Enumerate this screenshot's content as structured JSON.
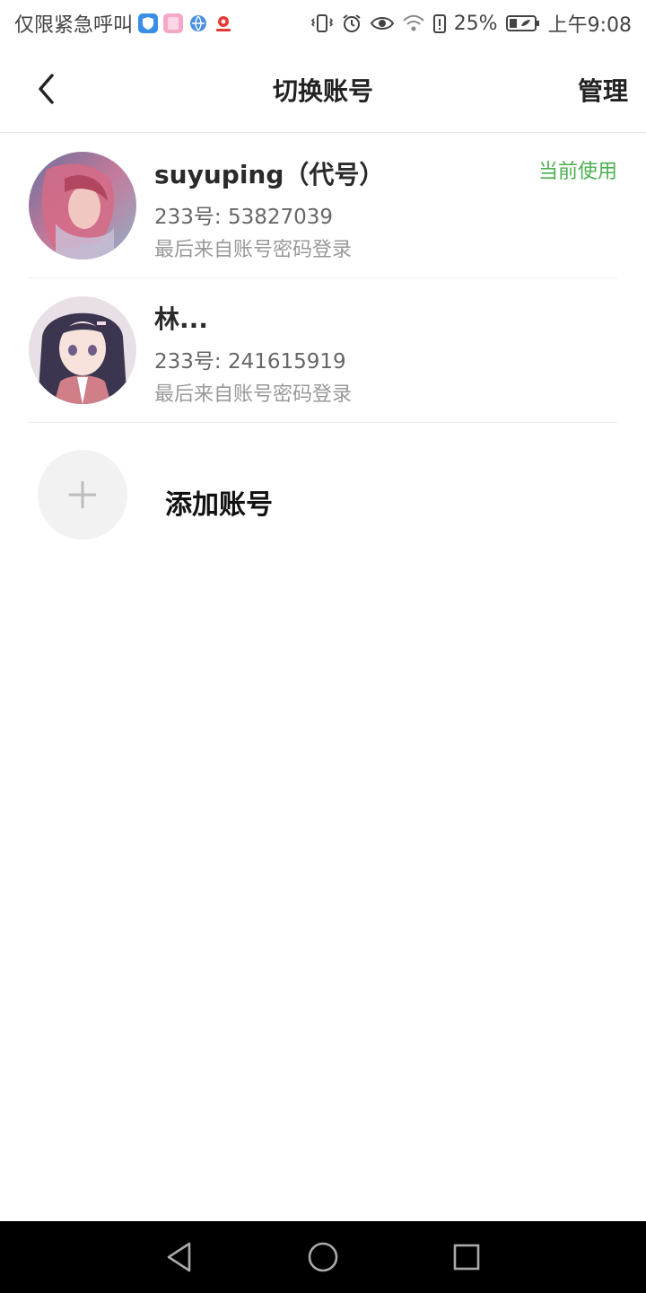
{
  "status_bar": {
    "carrier": "仅限紧急呼叫",
    "battery": "25%",
    "time": "上午9:08",
    "icons": [
      "shield-app-icon",
      "music-app-icon",
      "browser-app-icon",
      "map-app-icon",
      "vibrate-icon",
      "alarm-icon",
      "eye-icon",
      "wifi-icon",
      "battery-alert-icon",
      "battery-icon"
    ]
  },
  "header": {
    "title": "切换账号",
    "manage_label": "管理",
    "back_icon": "chevron-left-icon"
  },
  "accounts": [
    {
      "name": "suyuping（代号）",
      "id_text": "233号: 53827039",
      "login_text": "最后来自账号密码登录",
      "current_label": "当前使用"
    },
    {
      "name": "林...",
      "id_text": "233号: 241615919",
      "login_text": "最后来自账号密码登录"
    }
  ],
  "add_account": {
    "label": "添加账号",
    "icon": "plus-icon"
  },
  "colors": {
    "accent_green": "#4caf50",
    "divider": "#ececec",
    "navbar": "#000000"
  },
  "navigation": {
    "icons": [
      "back-triangle-icon",
      "home-circle-icon",
      "recents-square-icon"
    ]
  }
}
